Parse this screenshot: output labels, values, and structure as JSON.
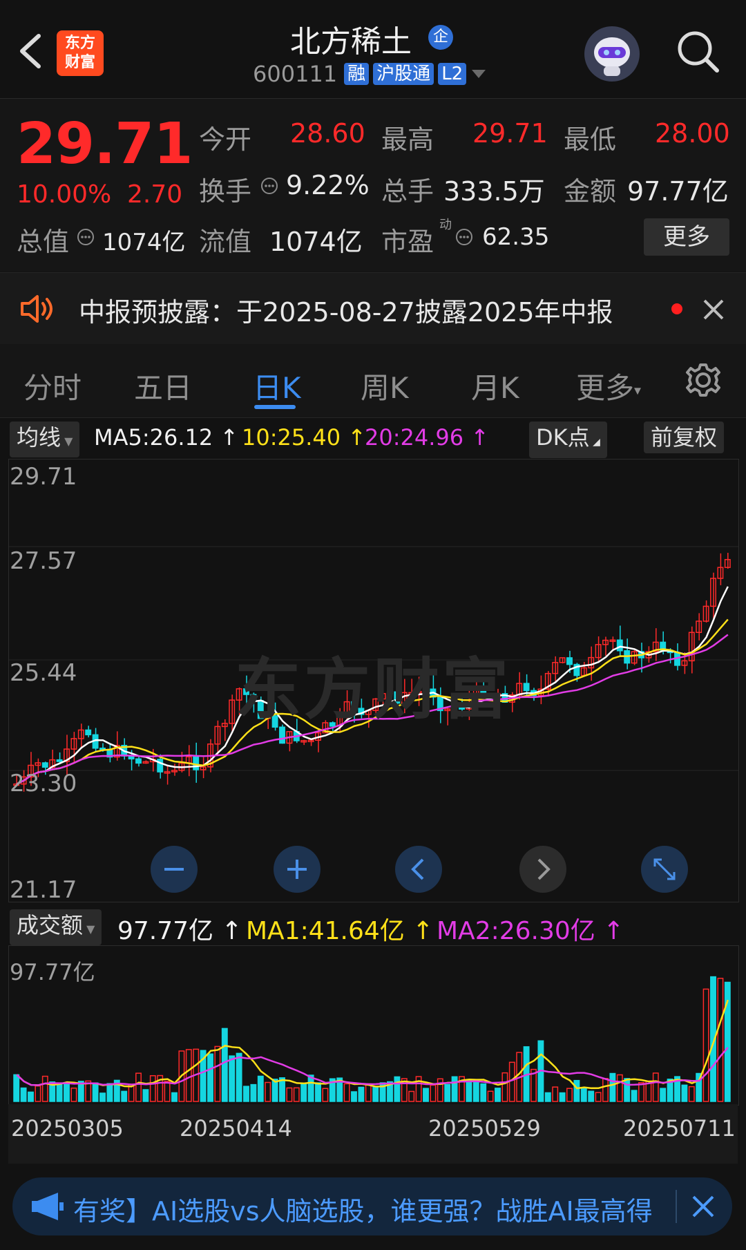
{
  "header": {
    "back_icon": "chevron-left-icon",
    "logo_text_line1": "东方",
    "logo_text_line2": "财富",
    "stock_name": "北方稀土",
    "stock_badge": "企",
    "stock_code": "600111",
    "tags": [
      "融",
      "沪股通",
      "L2"
    ],
    "search_icon": "search-icon",
    "avatar_icon": "robot-avatar-icon"
  },
  "quote": {
    "price": "29.71",
    "change_pct": "10.00%",
    "change_amt": "2.70",
    "open_label": "今开",
    "open_value": "28.60",
    "high_label": "最高",
    "high_value": "29.71",
    "low_label": "最低",
    "low_value": "28.00",
    "turnover_label": "换手",
    "turnover_value": "9.22%",
    "volume_label": "总手",
    "volume_value": "333.5万",
    "amount_label": "金额",
    "amount_value": "97.77亿",
    "mktcap_label": "总值",
    "mktcap_value": "1074亿",
    "float_label": "流值",
    "float_value": "1074亿",
    "pe_label": "市盈",
    "pe_sup": "动",
    "pe_value": "62.35",
    "more_button": "更多"
  },
  "notice": {
    "text": "中报预披露：于2025-08-27披露2025年中报",
    "speaker_icon": "speaker-icon",
    "close_icon": "close-icon"
  },
  "tabs": {
    "items": [
      "分时",
      "五日",
      "日K",
      "周K",
      "月K",
      "更多"
    ],
    "active": "日K",
    "settings_icon": "gear-icon"
  },
  "kline": {
    "indicator_select": "均线",
    "ma5": "MA5:26.12",
    "ma10": "10:25.40",
    "ma20": "20:24.96",
    "dk_button": "DK点",
    "adjust_button": "前复权",
    "y_labels": [
      "29.71",
      "27.57",
      "25.44",
      "23.30",
      "21.17"
    ],
    "watermark": "东方财富",
    "colors": {
      "up": "#ff2a2a",
      "down": "#15d6e0",
      "ma5": "#ffffff",
      "ma10": "#ffe119",
      "ma20": "#e23ce6"
    }
  },
  "volume": {
    "indicator_select": "成交额",
    "amount": "97.77亿",
    "ma1": "MA1:41.64亿",
    "ma2": "MA2:26.30亿",
    "y_label": "97.77亿",
    "dates": [
      "20250305",
      "20250414",
      "20250529",
      "20250711"
    ]
  },
  "banner": {
    "text": "有奖】AI选股vs人脑选股，谁更强？战胜AI最高得",
    "megaphone_icon": "megaphone-icon",
    "close_icon": "close-icon"
  }
}
